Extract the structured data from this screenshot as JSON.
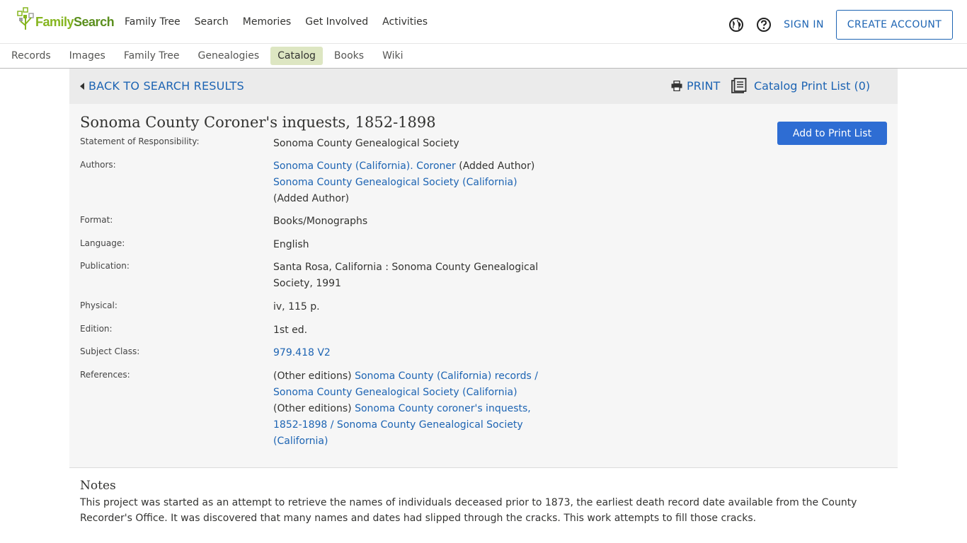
{
  "header": {
    "logo_family": "Family",
    "logo_search": "Search",
    "nav": [
      "Family Tree",
      "Search",
      "Memories",
      "Get Involved",
      "Activities"
    ],
    "sign_in": "SIGN IN",
    "create_account": "CREATE ACCOUNT",
    "icons": [
      "globe-icon",
      "help-icon"
    ]
  },
  "subnav": {
    "items": [
      "Records",
      "Images",
      "Family Tree",
      "Genealogies",
      "Catalog",
      "Books",
      "Wiki"
    ],
    "active": "Catalog"
  },
  "toolbar": {
    "back": "BACK TO SEARCH RESULTS",
    "print": "PRINT",
    "print_list": "Catalog Print List (0)"
  },
  "record": {
    "title": "Sonoma County Coroner's inquests, 1852-1898",
    "add_button": "Add to Print List",
    "statement_label": "Statement of Responsibility:",
    "statement": "Sonoma County Genealogical Society",
    "authors_label": "Authors:",
    "author1_link": "Sonoma County (California). Coroner",
    "author1_role": " (Added Author)",
    "author2_link": "Sonoma County Genealogical Society (California)",
    "author2_role": "(Added Author)",
    "format_label": "Format:",
    "format": "Books/Monographs",
    "language_label": "Language:",
    "language": "English",
    "publication_label": "Publication:",
    "publication": "Santa Rosa, California : Sonoma County Genealogical Society, 1991",
    "physical_label": "Physical:",
    "physical": "iv, 115 p.",
    "edition_label": "Edition:",
    "edition": "1st ed.",
    "subject_label": "Subject Class:",
    "subject": "979.418 V2",
    "references_label": "References:",
    "ref1_prefix": "(Other editions) ",
    "ref1_link": "Sonoma County (California) records / Sonoma County Genealogical Society (California)",
    "ref2_prefix": "(Other editions) ",
    "ref2_link": "Sonoma County coroner's inquests, 1852-1898 / Sonoma County Genealogical Society (California)"
  },
  "notes": {
    "heading": "Notes",
    "text": "This project was started as an attempt to retrieve the names of individuals deceased prior to 1873, the earliest death record date available from the County Recorder's Office. It was discovered that many names and dates had slipped through the cracks. This work attempts to fill those cracks."
  },
  "colors": {
    "link": "#1d64b3",
    "button": "#2e6dd3",
    "active_tab": "#dde6c2",
    "logo_green": "#85b51f"
  }
}
